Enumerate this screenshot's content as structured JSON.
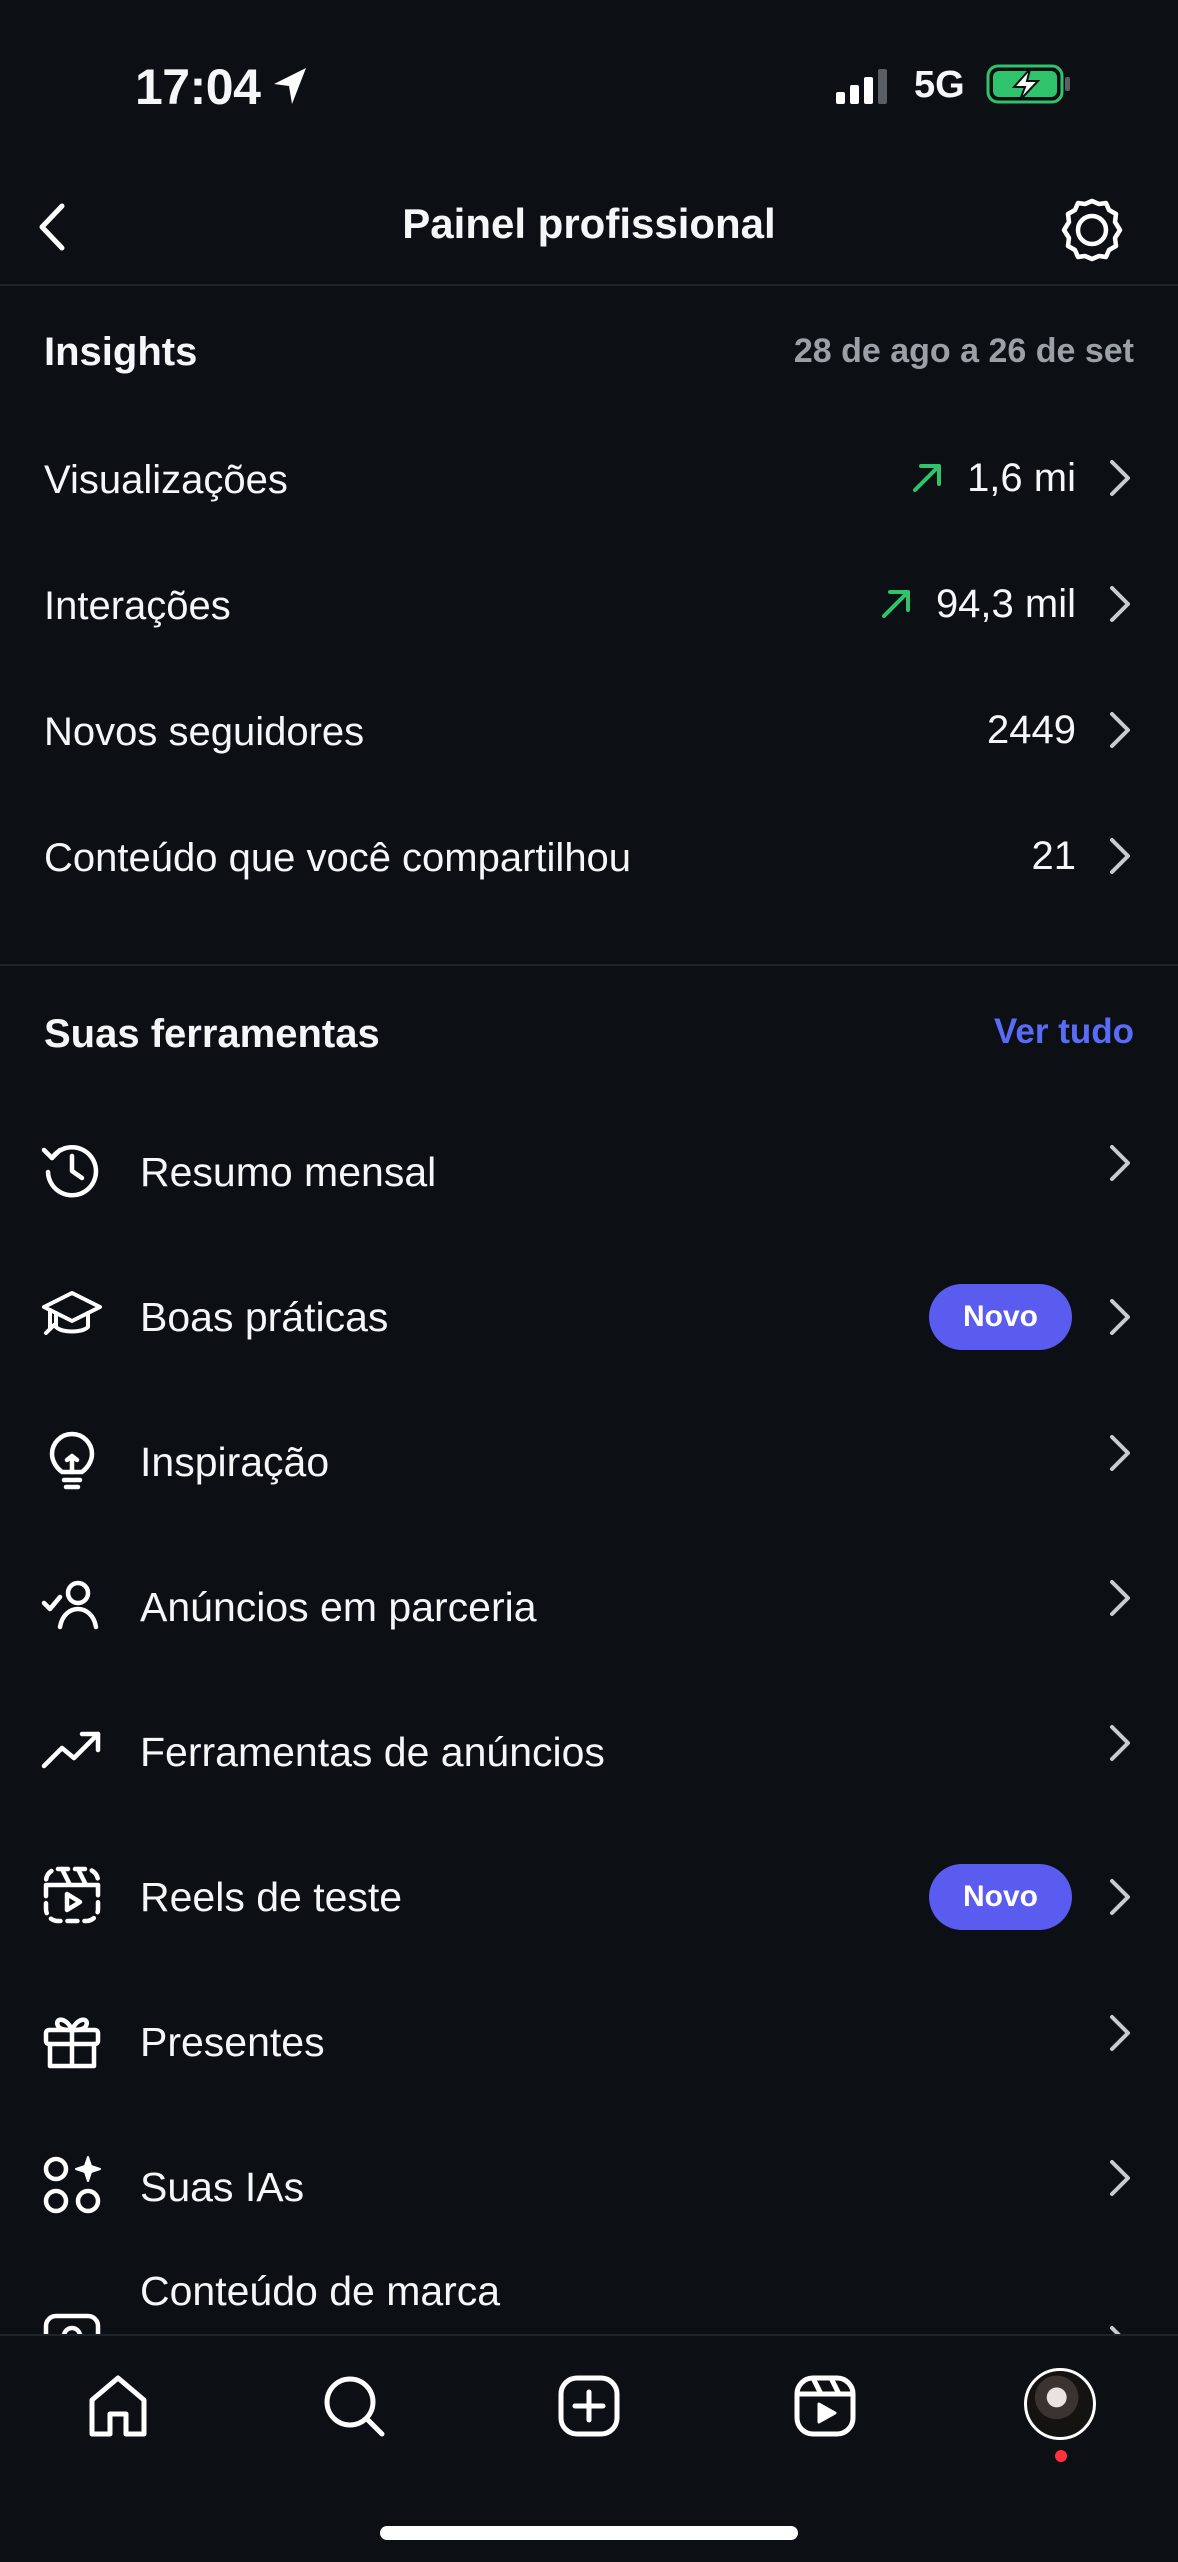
{
  "status_bar": {
    "time": "17:04",
    "network": "5G"
  },
  "header": {
    "title": "Painel profissional"
  },
  "insights": {
    "title": "Insights",
    "date_range": "28 de ago a 26 de set",
    "rows": [
      {
        "label": "Visualizações",
        "value": "1,6 mi",
        "trend": "up"
      },
      {
        "label": "Interações",
        "value": "94,3 mil",
        "trend": "up"
      },
      {
        "label": "Novos seguidores",
        "value": "2449"
      },
      {
        "label": "Conteúdo que você compartilhou",
        "value": "21"
      }
    ]
  },
  "tools": {
    "title": "Suas ferramentas",
    "see_all": "Ver tudo",
    "items": [
      {
        "label": "Resumo mensal",
        "icon": "history-icon"
      },
      {
        "label": "Boas práticas",
        "icon": "graduation-cap-icon",
        "badge": "Novo"
      },
      {
        "label": "Inspiração",
        "icon": "lightbulb-icon"
      },
      {
        "label": "Anúncios em parceria",
        "icon": "person-check-icon"
      },
      {
        "label": "Ferramentas de anúncios",
        "icon": "trending-up-icon"
      },
      {
        "label": "Reels de teste",
        "icon": "reels-test-icon",
        "badge": "Novo"
      },
      {
        "label": "Presentes",
        "icon": "gift-icon"
      },
      {
        "label": "Suas IAs",
        "icon": "ai-sparkle-icon"
      },
      {
        "label": "Conteúdo de marca",
        "icon": "branded-content-icon"
      }
    ]
  },
  "bottom_nav": [
    "home-icon",
    "search-icon",
    "create-icon",
    "reels-icon",
    "profile-avatar"
  ],
  "colors": {
    "background": "#0c1015",
    "accent": "#5a6cf5",
    "badge": "#5a5cf0",
    "trend_up": "#2fc46b"
  }
}
